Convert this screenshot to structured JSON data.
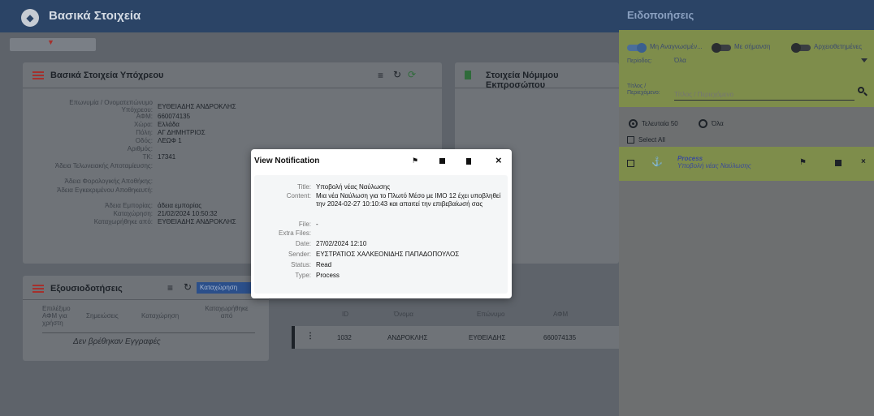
{
  "app": {
    "title": "Βασικά Στοιχεία",
    "dropdown_caret": "▼"
  },
  "card_main": {
    "title": "Βασικά Στοιχεία Υπόχρεου",
    "fields": [
      {
        "label": "Επωνυμία / Ονοματεπώνυμο Υπόχρεου:",
        "value": "ΕΥΘΕΙΑΔΗΣ ΑΝΔΡΟΚΛΗΣ"
      },
      {
        "label": "ΑΦΜ:",
        "value": "660074135"
      },
      {
        "label": "Χώρα:",
        "value": "Ελλάδα"
      },
      {
        "label": "Πόλη:",
        "value": "ΑΓ ΔΗΜΗΤΡΙΟΣ"
      },
      {
        "label": "Οδός:",
        "value": "ΛΕΩΦ 1"
      },
      {
        "label": "Αριθμός:",
        "value": ""
      },
      {
        "label": "ΤΚ:",
        "value": "17341"
      },
      {
        "label": "Άδεια Τελωνειακής Αποταμίευσης:",
        "value": ""
      },
      {
        "label": "Άδεια Φορολογικής Αποθήκης:",
        "value": ""
      },
      {
        "label": "Άδεια Εγκεκριμένου Αποθηκευτή:",
        "value": ""
      },
      {
        "label": "Άδεια Εμπορίας:",
        "value": "άδεια εμπορίας"
      },
      {
        "label": "Καταχώρηση:",
        "value": "21/02/2024 10:50:32"
      },
      {
        "label": "Καταχωρήθηκε από:",
        "value": "ΕΥΘΕΙΑΔΗΣ ΑΝΔΡΟΚΛΗΣ"
      }
    ]
  },
  "card_rep": {
    "title": "Στοιχεία Νόμιμου Εκπροσώπου"
  },
  "card_auth": {
    "title": "Εξουσιοδοτήσεις",
    "add_button": "Καταχώρηση",
    "headers": [
      "Επιλέξιμο ΑΦΜ για χρήστη",
      "Σημειώσεις",
      "Καταχώρηση",
      "Καταχωρήθηκε από"
    ],
    "empty": "Δεν βρέθηκαν Εγγραφές"
  },
  "rep_table": {
    "headers": [
      "ID",
      "Όνομα",
      "Επώνυμο",
      "ΑΦΜ"
    ],
    "row": [
      "1032",
      "ΑΝΔΡΟΚΛΗΣ",
      "ΕΥΘΕΙΑΔΗΣ",
      "660074135"
    ]
  },
  "notifications": {
    "title": "Ειδοποιήσεις",
    "toggles": [
      {
        "label": "Μη Αναγνωσμέν...",
        "on": true
      },
      {
        "label": "Με σήμανση",
        "on": false
      },
      {
        "label": "Αρχειοθετημένες",
        "on": false
      }
    ],
    "period_label": "Περίοδος:",
    "period_value": "Όλα",
    "title_label": "Τίτλος / Περιεχόμενο:",
    "search_placeholder": "Τίτλος / Περιεχόμενο",
    "radio_last": "Τελευταία 50",
    "radio_all": "Όλα",
    "select_all": "Select All",
    "item": {
      "title": "Process",
      "subtitle": "Υποβολή νέας Ναύλωσης"
    }
  },
  "modal": {
    "title": "View Notification",
    "fields": [
      {
        "key": "Title:",
        "value": "Υποβολή νέας Ναύλωσης"
      },
      {
        "key": "Content:",
        "value": "Μια νέα Ναύλωση για το Πλωτό Μέσο με ΙΜΟ 12 έχει υποβληθεί την 2024-02-27 10:10:43 και απαιτεί την επιβεβαίωσή σας"
      },
      {
        "key": "File:",
        "value": "-"
      },
      {
        "key": "Extra Files:",
        "value": ""
      },
      {
        "key": "Date:",
        "value": "27/02/2024 12:10"
      },
      {
        "key": "Sender:",
        "value": "ΕΥΣΤΡΑΤΙΟΣ ΧΑΛΚΕΟΝΙΔΗΣ ΠΑΠΑΔΟΠΟΥΛΟΣ"
      },
      {
        "key": "Status:",
        "value": "Read"
      },
      {
        "key": "Type:",
        "value": "Process"
      }
    ]
  }
}
